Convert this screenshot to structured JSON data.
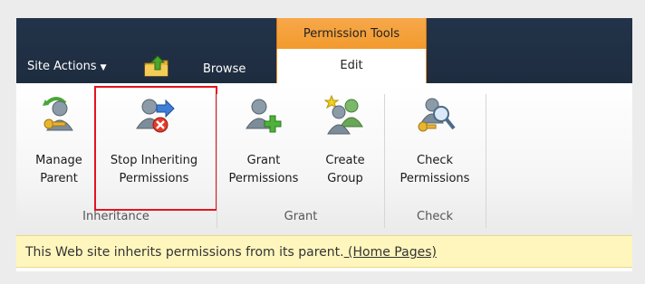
{
  "topbar": {
    "site_actions_label": "Site Actions",
    "browse_tab_label": "Browse",
    "context_group_title": "Permission Tools",
    "edit_tab_label": "Edit"
  },
  "ribbon": {
    "groups": [
      {
        "label": "Inheritance",
        "buttons": [
          {
            "label_line1": "Manage",
            "label_line2": "Parent",
            "icon": "manage-parent-icon"
          },
          {
            "label_line1": "Stop Inheriting",
            "label_line2": "Permissions",
            "icon": "stop-inheriting-icon"
          }
        ]
      },
      {
        "label": "Grant",
        "buttons": [
          {
            "label_line1": "Grant",
            "label_line2": "Permissions",
            "icon": "grant-permissions-icon"
          },
          {
            "label_line1": "Create",
            "label_line2": "Group",
            "icon": "create-group-icon"
          }
        ]
      },
      {
        "label": "Check",
        "buttons": [
          {
            "label_line1": "Check",
            "label_line2": "Permissions",
            "icon": "check-permissions-icon"
          }
        ]
      }
    ]
  },
  "status": {
    "message": "This Web site inherits permissions from its parent.",
    "link_text": " (Home Pages)"
  },
  "colors": {
    "topbar": "#223349",
    "context_tab": "#f29a2e",
    "highlight_border": "#e3141f",
    "status_background": "#fff6bd"
  }
}
